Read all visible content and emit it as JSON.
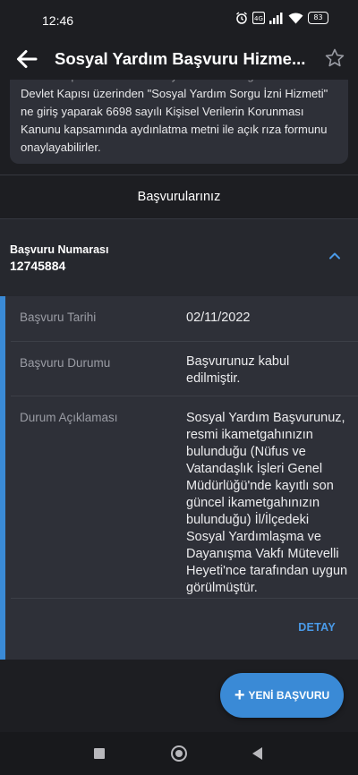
{
  "status_bar": {
    "time": "12:46",
    "battery": "83",
    "icons": [
      "alarm-icon",
      "volte-icon",
      "signal-icon",
      "wifi-icon",
      "battery-icon"
    ]
  },
  "app_bar": {
    "title": "Sosyal Yardım Başvuru Hizmeti",
    "title_display": "Sosyal Yardım Başvuru Hizme...",
    "back_icon": "arrow-left-icon",
    "favorite_icon": "star-outline-icon"
  },
  "info_card": {
    "text_lines": [
      "Devlet Kapısı üzerinden \"Sosyal Yardım Sorgu İzni Hizmeti\"",
      "ne giriş yaparak 6698 sayılı Kişisel Verilerin Korunması",
      "Kanunu kapsamında aydınlatma metni ile açık rıza formunu",
      "onaylayabilirler."
    ]
  },
  "section": {
    "title": "Başvurularınız"
  },
  "application": {
    "number_label": "Başvuru Numarası",
    "number_value": "12745884",
    "expand_icon": "chevron-up-icon",
    "details": [
      {
        "key": "Başvuru Tarihi",
        "value": "02/11/2022"
      },
      {
        "key": "Başvuru Durumu",
        "value": "Başvurunuz kabul edilmiştir."
      },
      {
        "key": "Durum Açıklaması",
        "value": "Sosyal Yardım Başvurunuz, resmi ikametgahınızın bulunduğu (Nüfus ve Vatandaşlık İşleri Genel Müdürlüğü'nde kayıtlı son güncel ikametgahınızın bulunduğu) İl/İlçedeki Sosyal Yardımlaşma ve Dayanışma Vakfı Mütevelli Heyeti'nce tarafından uygun görülmüştür."
      }
    ],
    "detail_button": "DETAY"
  },
  "fab": {
    "label": "YENİ BAŞVURU",
    "icon": "plus-icon"
  },
  "nav_bar": {
    "icons": [
      "recents-square-icon",
      "home-circle-icon",
      "back-triangle-icon"
    ]
  },
  "colors": {
    "accent": "#3a8ad6",
    "background": "#1d1e22",
    "card": "#2e3038"
  }
}
